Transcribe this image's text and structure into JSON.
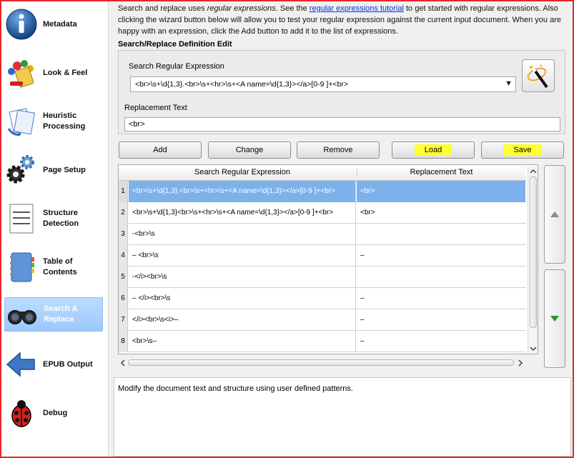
{
  "sidebar": {
    "items": [
      {
        "label": "Metadata",
        "icon": "info-icon"
      },
      {
        "label": "Look & Feel",
        "icon": "paint-icon"
      },
      {
        "label": "Heuristic Processing",
        "icon": "documents-icon"
      },
      {
        "label": "Page Setup",
        "icon": "gears-icon"
      },
      {
        "label": "Structure Detection",
        "icon": "page-lines-icon"
      },
      {
        "label": "Table of Contents",
        "icon": "notebook-icon"
      },
      {
        "label": "Search & Replace",
        "icon": "binoculars-icon",
        "active": true
      },
      {
        "label": "EPUB Output",
        "icon": "arrow-left-icon"
      },
      {
        "label": "Debug",
        "icon": "ladybug-icon"
      }
    ]
  },
  "intro": {
    "part1": "Search and replace uses ",
    "italic": "regular expressions",
    "part2": ". See the ",
    "link": "regular expressions tutorial",
    "part3": " to get started with regular expressions. Also clicking the wizard button below will allow you to test your regular expression against the current input document. When you are happy with an expression, click the Add button to add it to the list of expressions."
  },
  "edit": {
    "section_title": "Search/Replace Definition Edit",
    "search_label": "Search Regular Expression",
    "search_value": "<br>\\s+\\d{1,3}.<br>\\s+<hr>\\s+<A name=\\d{1,3}></a>[0-9 ]+<br>",
    "replace_label": "Replacement Text",
    "replace_value": "<br>"
  },
  "buttons": {
    "add": "Add",
    "change": "Change",
    "remove": "Remove",
    "load": "Load",
    "save": "Save"
  },
  "table": {
    "headers": [
      "Search Regular Expression",
      "Replacement Text"
    ],
    "rows": [
      {
        "num": "1",
        "search": "<br>\\s+\\d{1,3}.<br>\\s+<hr>\\s+<A name=\\d{1,3}></a>[0-9 ]+<br>",
        "replace": "<br>"
      },
      {
        "num": "2",
        "search": "<br>\\s+\\d{1,3}<br>\\s+<hr>\\s+<A name=\\d{1,3}></a>[0-9 ]+<br>",
        "replace": "<br>"
      },
      {
        "num": "3",
        "search": "-<br>\\s",
        "replace": ""
      },
      {
        "num": "4",
        "search": "– <br>\\s",
        "replace": "–"
      },
      {
        "num": "5",
        "search": "-</i><br>\\s",
        "replace": ""
      },
      {
        "num": "6",
        "search": "– </i><br>\\s",
        "replace": "–"
      },
      {
        "num": "7",
        "search": "</i><br>\\s<i>–",
        "replace": "–"
      },
      {
        "num": "8",
        "search": "<br>\\s–",
        "replace": "–"
      }
    ]
  },
  "description": "Modify the document text and structure using user defined patterns.",
  "colors": {
    "frame": "#e8262b",
    "selection": "#7cb1ea",
    "highlight": "#ffff33",
    "link": "#0033cc"
  }
}
